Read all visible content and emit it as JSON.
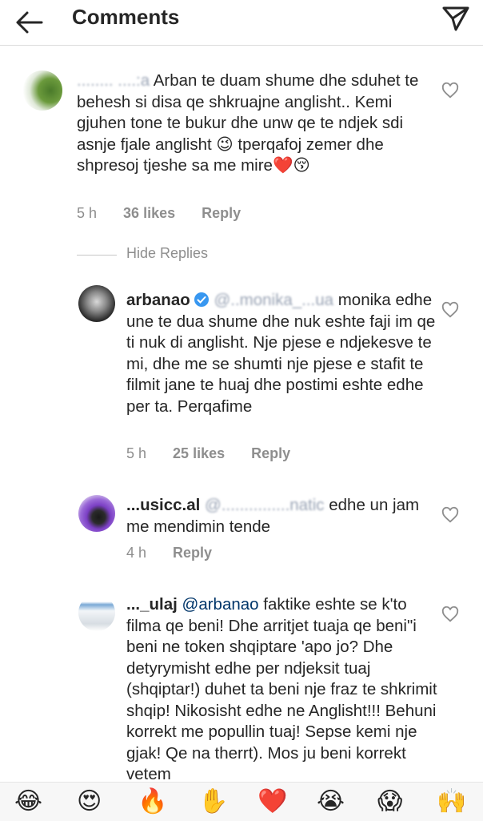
{
  "header": {
    "title": "Comments"
  },
  "comments": [
    {
      "user_redacted": "........ ....:a",
      "text": " Arban te duam shume dhe sduhet te behesh si disa qe shkruajne anglisht.. Kemi gjuhen tone te bukur dhe unw qe te ndjek sdi asnje fjale anglisht 😉 tperqafoj zemer dhe shpresoj tjeshe sa me mire❤️😚",
      "time": "5 h",
      "likes": "36 likes",
      "reply": "Reply"
    }
  ],
  "hide_replies": "Hide Replies",
  "replies": [
    {
      "user": "arbanao",
      "mention_redacted": "@..monika_...ua",
      "text": " monika edhe une te dua shume dhe nuk eshte faji im qe ti nuk di anglisht. Nje pjese e ndjekesve te mi, dhe me se shumti nje pjese e stafit te filmit jane te huaj dhe postimi eshte edhe per ta. Perqafime",
      "time": "5 h",
      "likes": "25 likes",
      "reply": "Reply"
    },
    {
      "user": "...usicc.al",
      "mention_redacted": "@...............natic",
      "text": " edhe un jam me mendimin tende",
      "time": "4 h",
      "reply": "Reply"
    },
    {
      "user": "..._ulaj",
      "mention": "@arbanao",
      "text": " faktike eshte se k'to filma qe beni! Dhe arritjet tuaja qe beni\"i beni ne token shqiptare 'apo jo? Dhe detyrymisht edhe per ndjeksit tuaj (shqiptar!) duhet ta beni nje fraz te shkrimit shqip! Nikosisht edhe ne Anglisht!!! Behuni korrekt me popullin tuaj! Sepse kemi nje gjak!  Qe na therrt). Mos ju beni korrekt vetem"
    }
  ],
  "emoji_bar": [
    "😂",
    "😍",
    "🔥",
    "✋",
    "❤️",
    "😭",
    "😱",
    "🙌"
  ]
}
